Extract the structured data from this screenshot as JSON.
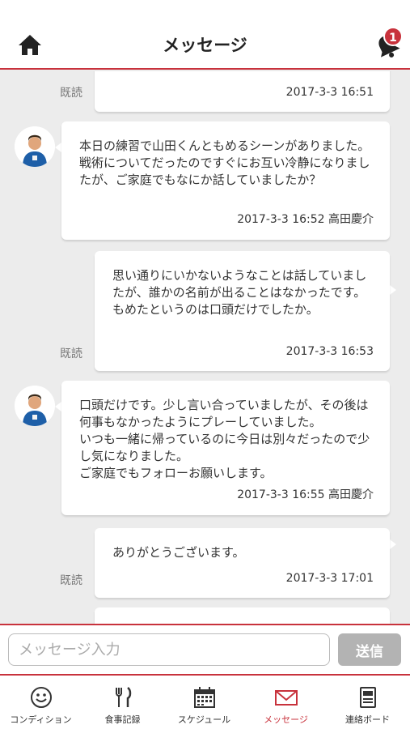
{
  "header": {
    "title": "メッセージ",
    "notification_count": "1"
  },
  "messages": [
    {
      "side": "right",
      "read_label": "既読",
      "text": "",
      "meta": "2017-3-3 16:51"
    },
    {
      "side": "left",
      "text": "本日の練習で山田くんともめるシーンがありました。戦術についてだったのですぐにお互い冷静になりましたが、ご家庭でもなにか話していましたか？",
      "meta": "2017-3-3 16:52 高田慶介"
    },
    {
      "side": "right",
      "read_label": "既読",
      "text": "思い通りにいかないようなことは話していましたが、誰かの名前が出ることはなかったです。もめたというのは口頭だけでしたか。",
      "meta": "2017-3-3 16:53"
    },
    {
      "side": "left",
      "text": "口頭だけです。少し言い合っていましたが、その後は何事もなかったようにプレーしていました。\nいつも一緒に帰っているのに今日は別々だったので少し気になりました。\nご家庭でもフォローお願いします。",
      "meta": "2017-3-3 16:55 高田慶介"
    },
    {
      "side": "right",
      "read_label": "既読",
      "text": "ありがとうございます。",
      "meta": "2017-3-3 17:01"
    }
  ],
  "composer": {
    "placeholder": "メッセージ入力",
    "value": "",
    "send_label": "送信"
  },
  "tabs": [
    {
      "label": "コンディション",
      "icon": "smiley-icon",
      "active": false
    },
    {
      "label": "食事記録",
      "icon": "fork-knife-icon",
      "active": false
    },
    {
      "label": "スケジュール",
      "icon": "calendar-icon",
      "active": false
    },
    {
      "label": "メッセージ",
      "icon": "envelope-icon",
      "active": true
    },
    {
      "label": "連絡ボード",
      "icon": "board-icon",
      "active": false
    }
  ],
  "colors": {
    "accent": "#c8323c",
    "background": "#ececec",
    "send_disabled": "#b3b3b3"
  }
}
